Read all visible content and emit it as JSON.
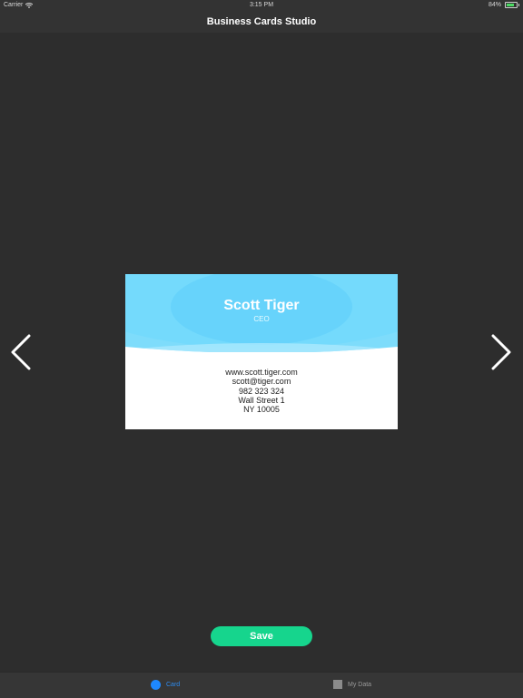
{
  "status_bar": {
    "carrier": "Carrier",
    "time": "3:15 PM",
    "battery_percent": "84%"
  },
  "nav": {
    "title": "Business Cards Studio"
  },
  "card": {
    "name": "Scott Tiger",
    "title": "CEO",
    "website": "www.scott.tiger.com",
    "email": "scott@tiger.com",
    "phone": "982 323 324",
    "street": "Wall Street 1",
    "city": "NY 10005",
    "accent_color": "#6fd9fb"
  },
  "actions": {
    "save_label": "Save",
    "save_color": "#16d58d"
  },
  "tabs": [
    {
      "label": "Card",
      "active": true,
      "icon": "circle-icon"
    },
    {
      "label": "My Data",
      "active": false,
      "icon": "square-icon"
    }
  ]
}
